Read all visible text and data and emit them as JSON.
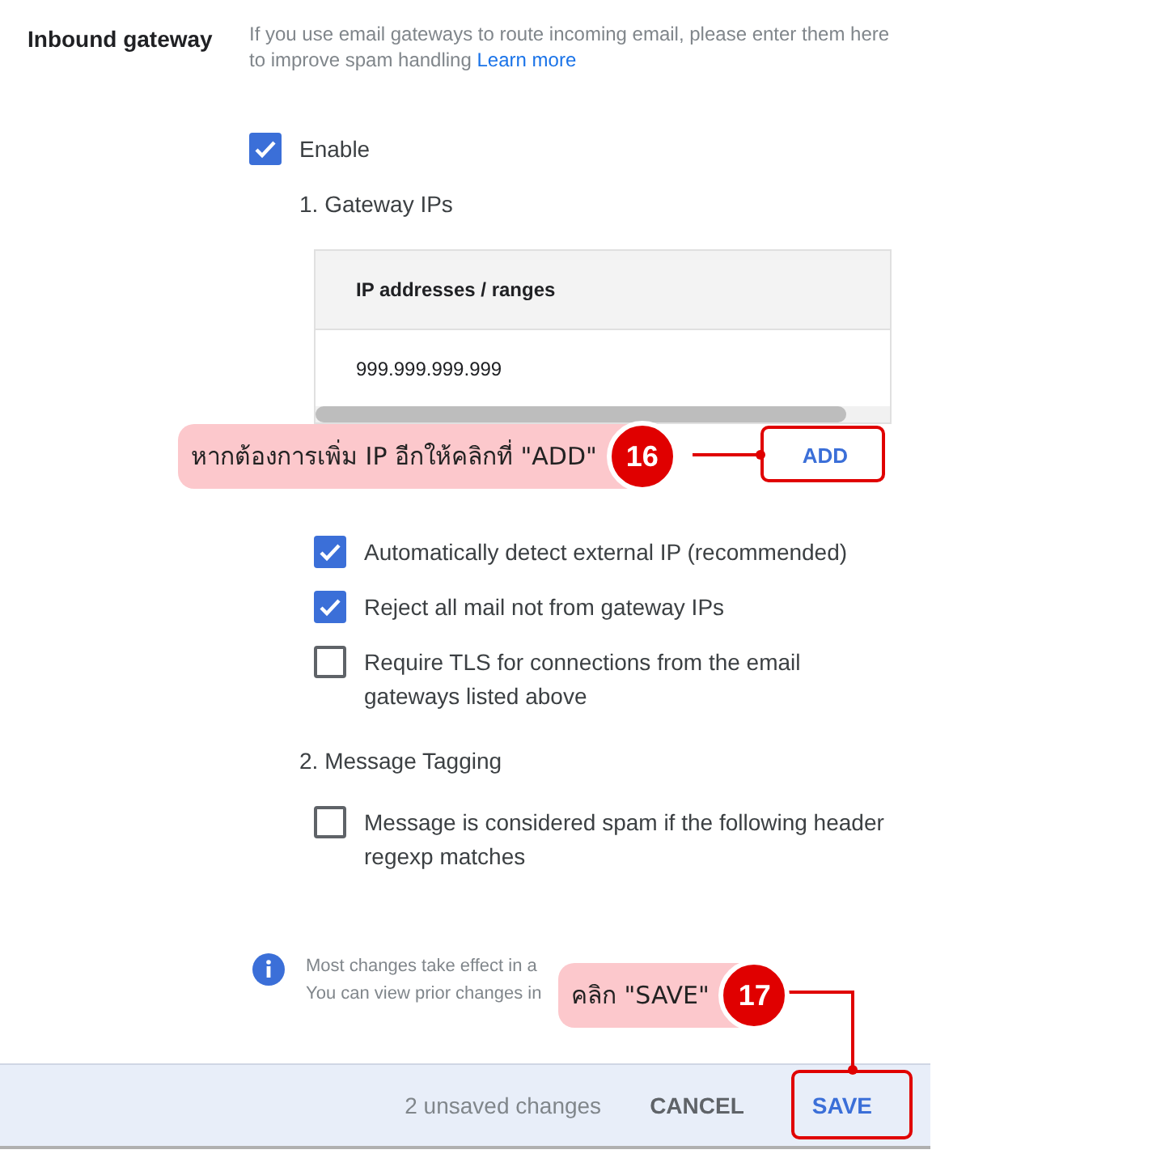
{
  "section": {
    "title": "Inbound gateway",
    "description": "If you use email gateways to route incoming email, please enter them here to improve spam handling",
    "link": "Learn more"
  },
  "enable": {
    "label": "Enable",
    "checked": true
  },
  "gateway_ips": {
    "heading": "1. Gateway IPs",
    "table": {
      "columns": [
        "IP addresses / ranges"
      ],
      "rows": [
        [
          "999.999.999.999"
        ]
      ]
    },
    "add_button": "ADD"
  },
  "options": [
    {
      "label": "Automatically detect external IP (recommended)",
      "checked": true
    },
    {
      "label": "Reject all mail not from gateway IPs",
      "checked": true
    },
    {
      "label": "Require TLS for connections from the email gateways listed above",
      "checked": false
    }
  ],
  "message_tagging": {
    "heading": "2. Message Tagging",
    "options": [
      {
        "label": "Message is considered spam if the following header regexp matches",
        "checked": false
      }
    ]
  },
  "info": {
    "lines": [
      "Most changes take effect in a",
      "You can view prior changes in"
    ]
  },
  "footer": {
    "status": "2 unsaved changes",
    "buttons": [
      "CANCEL",
      "SAVE"
    ]
  },
  "annotations": [
    {
      "number": "16",
      "text": "หากต้องการเพิ่ม IP อีกให้คลิกที่ \"ADD\""
    },
    {
      "number": "17",
      "text": "คลิก \"SAVE\""
    }
  ]
}
